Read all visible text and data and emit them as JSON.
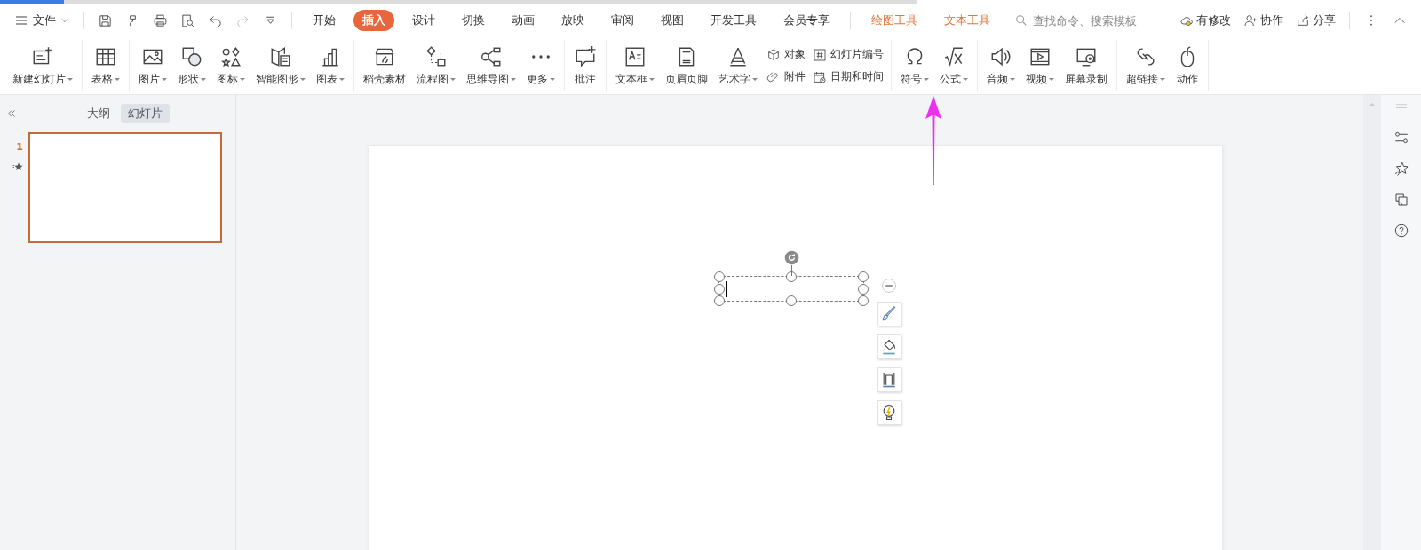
{
  "menu": {
    "file_label": "文件",
    "tabs": [
      {
        "label": "开始",
        "selected": false,
        "kind": "normal"
      },
      {
        "label": "插入",
        "selected": true,
        "kind": "normal"
      },
      {
        "label": "设计",
        "selected": false,
        "kind": "normal"
      },
      {
        "label": "切换",
        "selected": false,
        "kind": "normal"
      },
      {
        "label": "动画",
        "selected": false,
        "kind": "normal"
      },
      {
        "label": "放映",
        "selected": false,
        "kind": "normal"
      },
      {
        "label": "审阅",
        "selected": false,
        "kind": "normal"
      },
      {
        "label": "视图",
        "selected": false,
        "kind": "normal"
      },
      {
        "label": "开发工具",
        "selected": false,
        "kind": "normal"
      },
      {
        "label": "会员专享",
        "selected": false,
        "kind": "normal"
      },
      {
        "label": "绘图工具",
        "selected": false,
        "kind": "context"
      },
      {
        "label": "文本工具",
        "selected": false,
        "kind": "context"
      }
    ],
    "search": {
      "placeholder": "查找命令、搜索模板"
    },
    "actions": [
      {
        "label": "有修改"
      },
      {
        "label": "协作"
      },
      {
        "label": "分享"
      }
    ]
  },
  "ribbon": [
    {
      "tools": [
        {
          "kind": "large",
          "label": "新建幻灯片",
          "dropdown": true
        }
      ]
    },
    {
      "tools": [
        {
          "kind": "large",
          "label": "表格",
          "dropdown": true
        }
      ]
    },
    {
      "tools": [
        {
          "kind": "large",
          "label": "图片",
          "dropdown": true
        },
        {
          "kind": "large",
          "label": "形状",
          "dropdown": true
        },
        {
          "kind": "large",
          "label": "图标",
          "dropdown": true
        },
        {
          "kind": "large",
          "label": "智能图形",
          "dropdown": true
        },
        {
          "kind": "large",
          "label": "图表",
          "dropdown": true
        }
      ]
    },
    {
      "tools": [
        {
          "kind": "large",
          "label": "稻壳素材",
          "dropdown": false
        },
        {
          "kind": "large",
          "label": "流程图",
          "dropdown": true
        },
        {
          "kind": "large",
          "label": "思维导图",
          "dropdown": true
        },
        {
          "kind": "large",
          "label": "更多",
          "dropdown": true
        }
      ]
    },
    {
      "tools": [
        {
          "kind": "large",
          "label": "批注",
          "dropdown": false
        }
      ]
    },
    {
      "tools": [
        {
          "kind": "large",
          "label": "文本框",
          "dropdown": true
        },
        {
          "kind": "large",
          "label": "页眉页脚",
          "dropdown": false
        },
        {
          "kind": "large",
          "label": "艺术字",
          "dropdown": true
        },
        {
          "kind": "stack",
          "items": [
            {
              "label": "对象"
            },
            {
              "label": "附件"
            }
          ]
        },
        {
          "kind": "stack",
          "items": [
            {
              "label": "幻灯片编号"
            },
            {
              "label": "日期和时间"
            }
          ]
        }
      ]
    },
    {
      "tools": [
        {
          "kind": "large",
          "label": "符号",
          "dropdown": true
        },
        {
          "kind": "large",
          "label": "公式",
          "dropdown": true
        }
      ]
    },
    {
      "tools": [
        {
          "kind": "large",
          "label": "音频",
          "dropdown": true
        },
        {
          "kind": "large",
          "label": "视频",
          "dropdown": true
        },
        {
          "kind": "large",
          "label": "屏幕录制",
          "dropdown": false
        }
      ]
    },
    {
      "tools": [
        {
          "kind": "large",
          "label": "超链接",
          "dropdown": true
        },
        {
          "kind": "large",
          "label": "动作",
          "dropdown": false
        }
      ]
    }
  ],
  "panel": {
    "tabs": [
      {
        "label": "大纲",
        "selected": false
      },
      {
        "label": "幻灯片",
        "selected": true
      }
    ],
    "slides": [
      {
        "number": "1",
        "selected": true
      }
    ]
  }
}
